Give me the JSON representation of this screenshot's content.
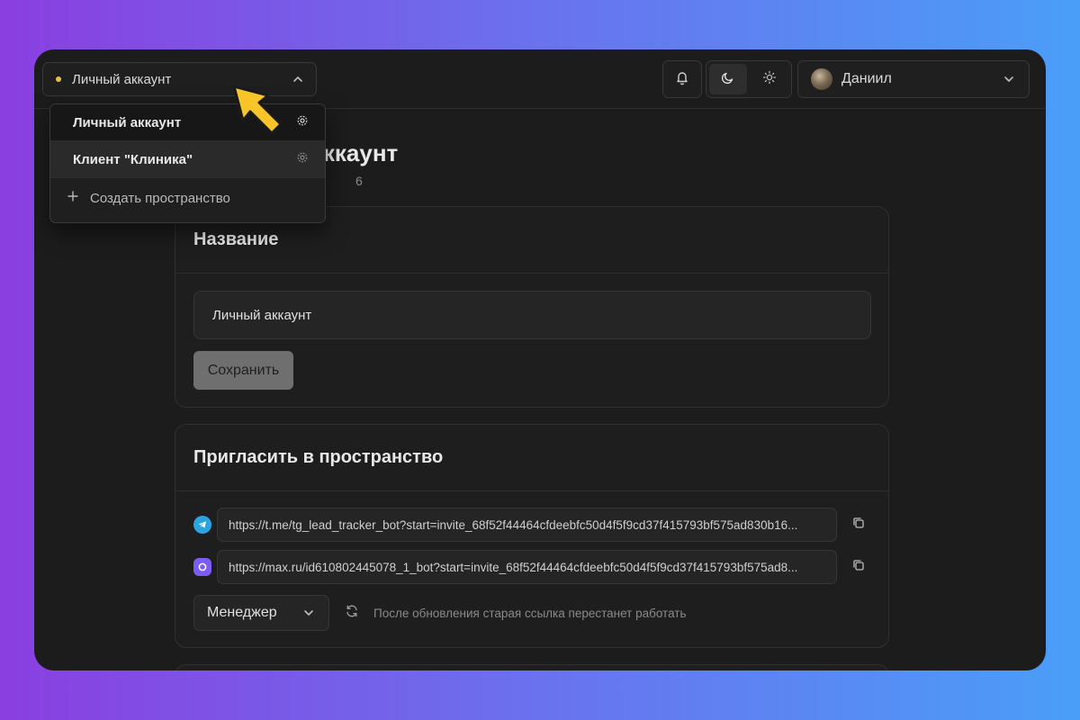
{
  "workspace_switcher": {
    "current": "Личный аккаунт",
    "dot_color": "#e8c24a"
  },
  "workspace_menu": {
    "items": [
      {
        "label": "Личный аккаунт"
      },
      {
        "label": "Клиент \"Клиника\""
      }
    ],
    "create_label": "Создать пространство"
  },
  "user": {
    "name": "Даниил"
  },
  "page": {
    "title_visible": "аккаунт",
    "subtitle_visible": "6"
  },
  "name_card": {
    "title": "Название",
    "input_value": "Личный аккаунт",
    "save_label": "Сохранить"
  },
  "invite_card": {
    "title": "Пригласить в пространство",
    "links": [
      {
        "icon": "telegram-icon",
        "url": "https://t.me/tg_lead_tracker_bot?start=invite_68f52f44464cfdeebfc50d4f5f9cd37f415793bf575ad830b16..."
      },
      {
        "icon": "max-icon",
        "url": "https://max.ru/id610802445078_1_bot?start=invite_68f52f44464cfdeebfc50d4f5f9cd37f415793bf575ad8..."
      }
    ],
    "role_selected": "Менеджер",
    "hint": "После обновления старая ссылка перестанет работать"
  },
  "colors": {
    "telegram": "#2aa3e0",
    "max": "#7b5cf6",
    "pointer": "#f7c42a"
  }
}
